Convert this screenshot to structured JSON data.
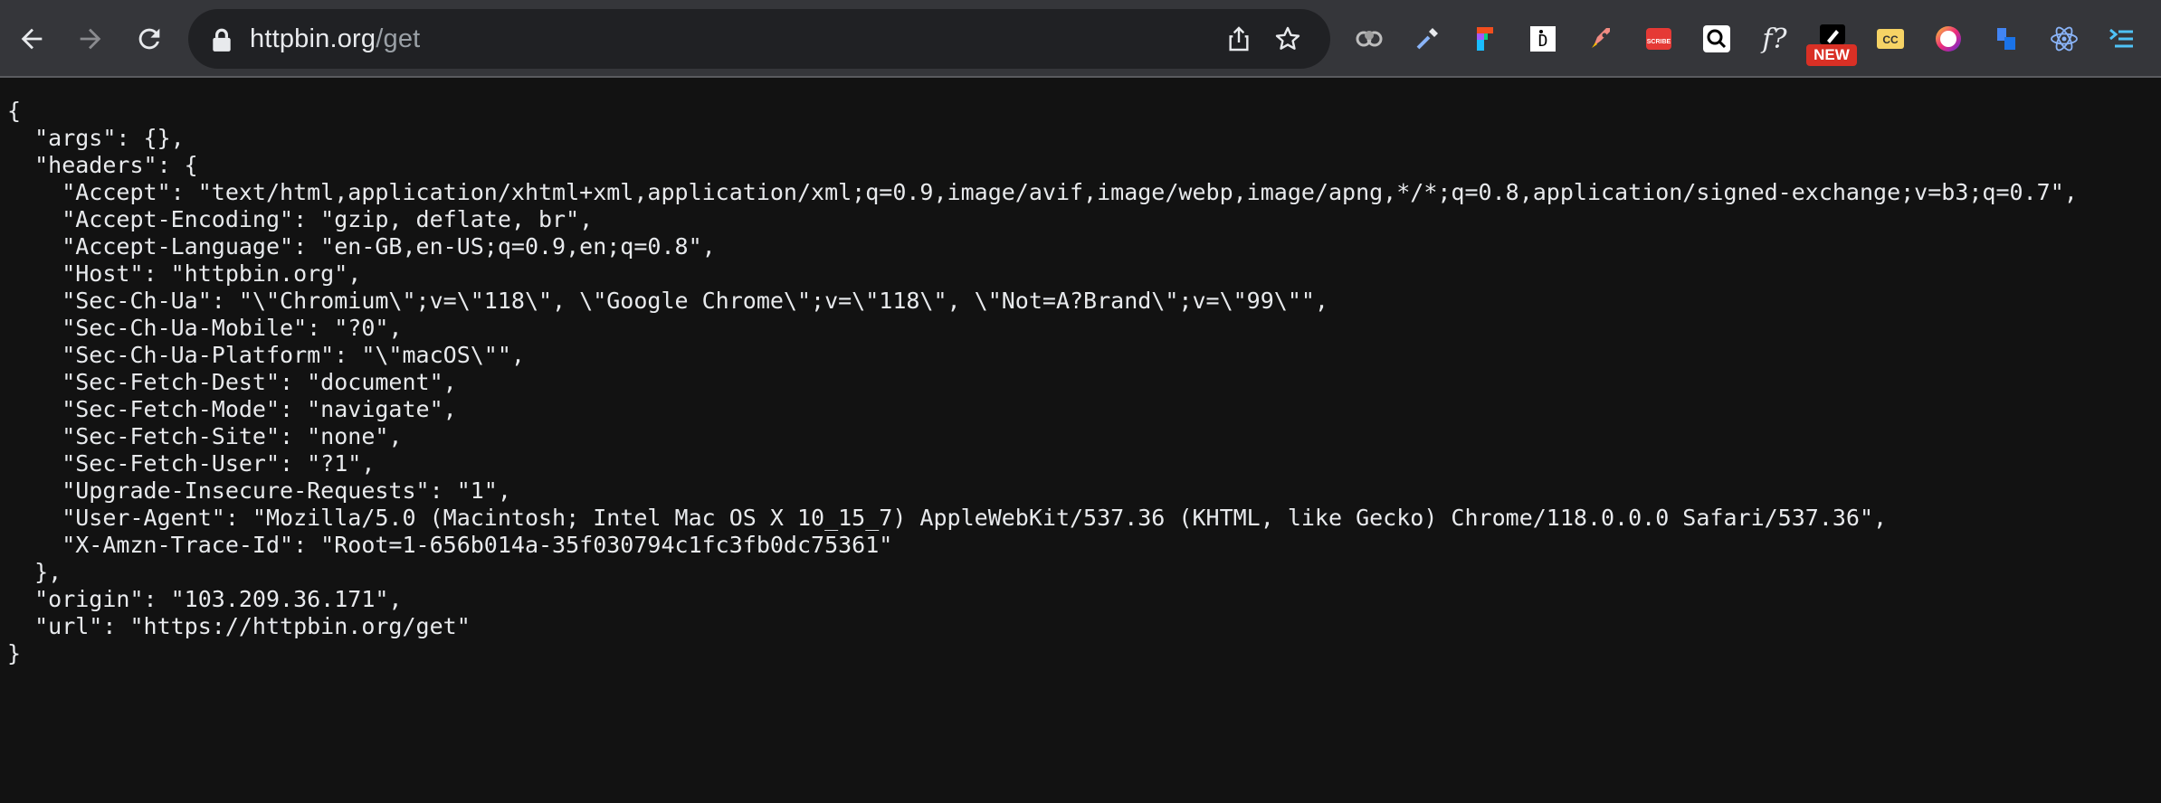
{
  "browser": {
    "url_host": "httpbin.org",
    "url_path": "/get",
    "icons": {
      "back": "arrow-left-icon",
      "forward": "arrow-right-icon",
      "reload": "reload-icon",
      "lock": "lock-icon",
      "share": "share-icon",
      "bookmark": "star-icon"
    },
    "extensions": [
      {
        "name": "extension-cloud-icon"
      },
      {
        "name": "extension-eyedropper-icon"
      },
      {
        "name": "extension-figma-icon"
      },
      {
        "name": "extension-id-icon"
      },
      {
        "name": "extension-rocket-icon"
      },
      {
        "name": "extension-scribe-icon",
        "label": "SCRIBE"
      },
      {
        "name": "extension-search-icon"
      },
      {
        "name": "extension-font-icon",
        "label": "f?"
      },
      {
        "name": "extension-pen-icon",
        "badge": "NEW"
      },
      {
        "name": "extension-cc-icon",
        "label": "CC"
      },
      {
        "name": "extension-ring-icon"
      },
      {
        "name": "extension-blocks-icon"
      },
      {
        "name": "extension-react-icon"
      },
      {
        "name": "extension-code-icon"
      }
    ]
  },
  "json_body": [
    "{",
    "  \"args\": {},",
    "  \"headers\": {",
    "    \"Accept\": \"text/html,application/xhtml+xml,application/xml;q=0.9,image/avif,image/webp,image/apng,*/*;q=0.8,application/signed-exchange;v=b3;q=0.7\",",
    "    \"Accept-Encoding\": \"gzip, deflate, br\",",
    "    \"Accept-Language\": \"en-GB,en-US;q=0.9,en;q=0.8\",",
    "    \"Host\": \"httpbin.org\",",
    "    \"Sec-Ch-Ua\": \"\\\"Chromium\\\";v=\\\"118\\\", \\\"Google Chrome\\\";v=\\\"118\\\", \\\"Not=A?Brand\\\";v=\\\"99\\\"\",",
    "    \"Sec-Ch-Ua-Mobile\": \"?0\",",
    "    \"Sec-Ch-Ua-Platform\": \"\\\"macOS\\\"\",",
    "    \"Sec-Fetch-Dest\": \"document\",",
    "    \"Sec-Fetch-Mode\": \"navigate\",",
    "    \"Sec-Fetch-Site\": \"none\",",
    "    \"Sec-Fetch-User\": \"?1\",",
    "    \"Upgrade-Insecure-Requests\": \"1\",",
    "    \"User-Agent\": \"Mozilla/5.0 (Macintosh; Intel Mac OS X 10_15_7) AppleWebKit/537.36 (KHTML, like Gecko) Chrome/118.0.0.0 Safari/537.36\",",
    "    \"X-Amzn-Trace-Id\": \"Root=1-656b014a-35f030794c1fc3fb0dc75361\"",
    "  },",
    "  \"origin\": \"103.209.36.171\",",
    "  \"url\": \"https://httpbin.org/get\"",
    "}"
  ]
}
